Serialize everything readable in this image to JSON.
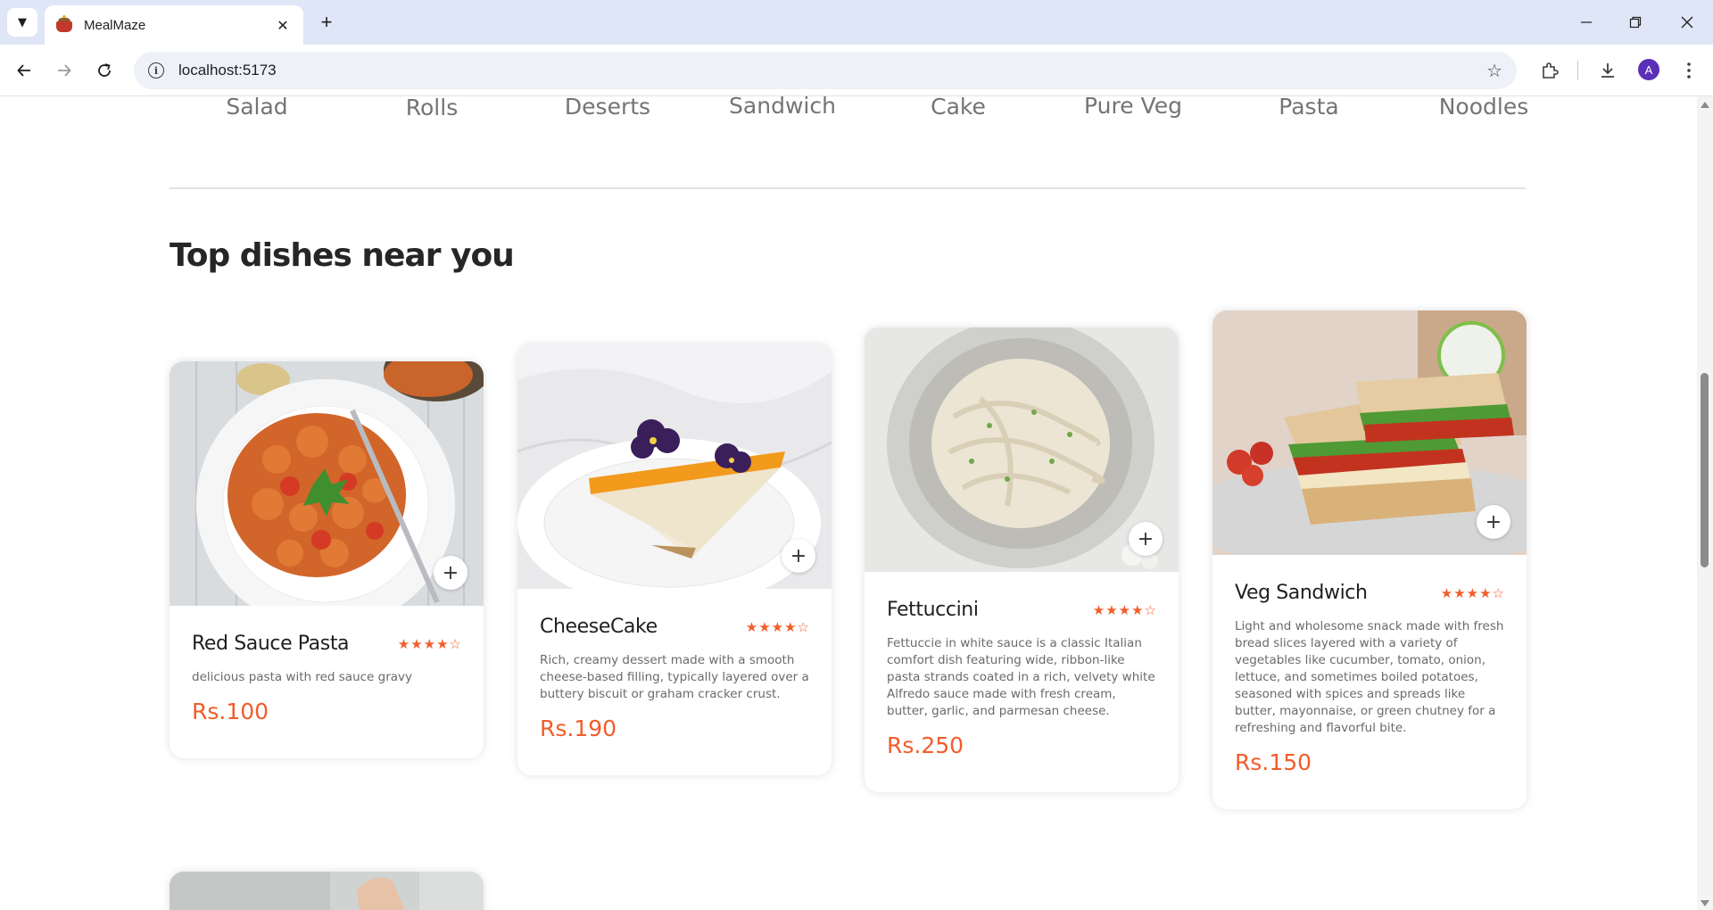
{
  "browser": {
    "tab_title": "MealMaze",
    "url": "localhost:5173",
    "avatar_letter": "A"
  },
  "categories": [
    "Salad",
    "Rolls",
    "Deserts",
    "Sandwich",
    "Cake",
    "Pure Veg",
    "Pasta",
    "Noodles"
  ],
  "section_title": "Top dishes near you",
  "dishes": [
    {
      "name": "Red Sauce Pasta",
      "rating": 4,
      "description": "delicious pasta with red sauce gravy",
      "price": "Rs.100"
    },
    {
      "name": "CheeseCake",
      "rating": 4,
      "description": "Rich, creamy dessert made with a smooth cheese-based filling, typically layered over a buttery biscuit or graham cracker crust.",
      "price": "Rs.190"
    },
    {
      "name": "Fettuccini",
      "rating": 4,
      "description": "Fettuccie in white sauce is a classic Italian comfort dish featuring wide, ribbon-like pasta strands coated in a rich, velvety white Alfredo sauce made with fresh cream, butter, garlic, and parmesan cheese.",
      "price": "Rs.250"
    },
    {
      "name": "Veg Sandwich",
      "rating": 4,
      "description": "Light and wholesome snack made with fresh bread slices layered with a variety of vegetables like cucumber, tomato, onion, lettuce, and sometimes boiled potatoes, seasoned with spices and spreads like butter, mayonnaise, or green chutney for a refreshing and flavorful bite.",
      "price": "Rs.150"
    }
  ],
  "colors": {
    "accent": "#f25c2a",
    "tabbar": "#dfe6f7",
    "omnibox": "#eff1f8"
  }
}
